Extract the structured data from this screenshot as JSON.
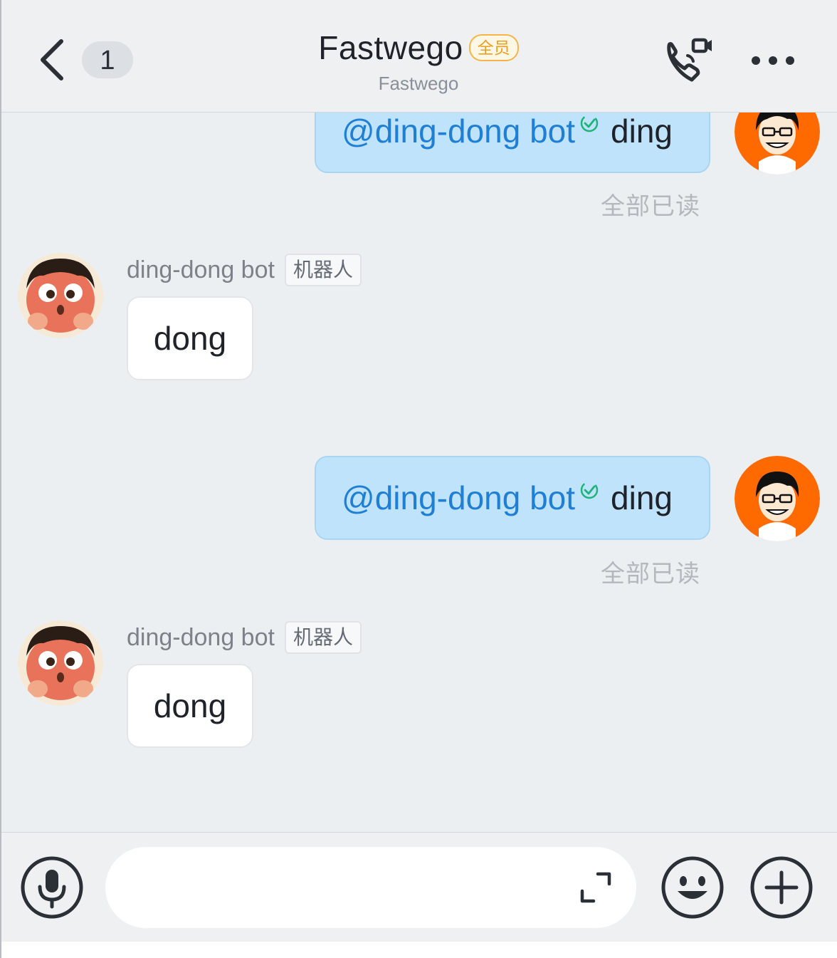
{
  "header": {
    "unread_count": "1",
    "title": "Fastwego",
    "member_tag": "全员",
    "subtitle": "Fastwego",
    "icons": {
      "back": "chevron-left-icon",
      "call": "phone-video-icon",
      "more": "more-horizontal-icon"
    }
  },
  "messages": [
    {
      "side": "right",
      "mention": "@ding-dong bot",
      "text": "ding",
      "status": "全部已读"
    },
    {
      "side": "left",
      "sender": "ding-dong bot",
      "sender_tag": "机器人",
      "text": "dong"
    },
    {
      "side": "right",
      "mention": "@ding-dong bot",
      "text": "ding",
      "status": "全部已读"
    },
    {
      "side": "left",
      "sender": "ding-dong bot",
      "sender_tag": "机器人",
      "text": "dong"
    }
  ],
  "composer": {
    "input_value": "",
    "icons": {
      "voice": "microphone-icon",
      "expand": "expand-icon",
      "emoji": "smiley-icon",
      "more": "plus-icon"
    }
  },
  "colors": {
    "mention": "#1f7fd4",
    "read_check": "#1fb37a",
    "member_tag": "#e9a020",
    "my_avatar_bg": "#ff6a00"
  }
}
